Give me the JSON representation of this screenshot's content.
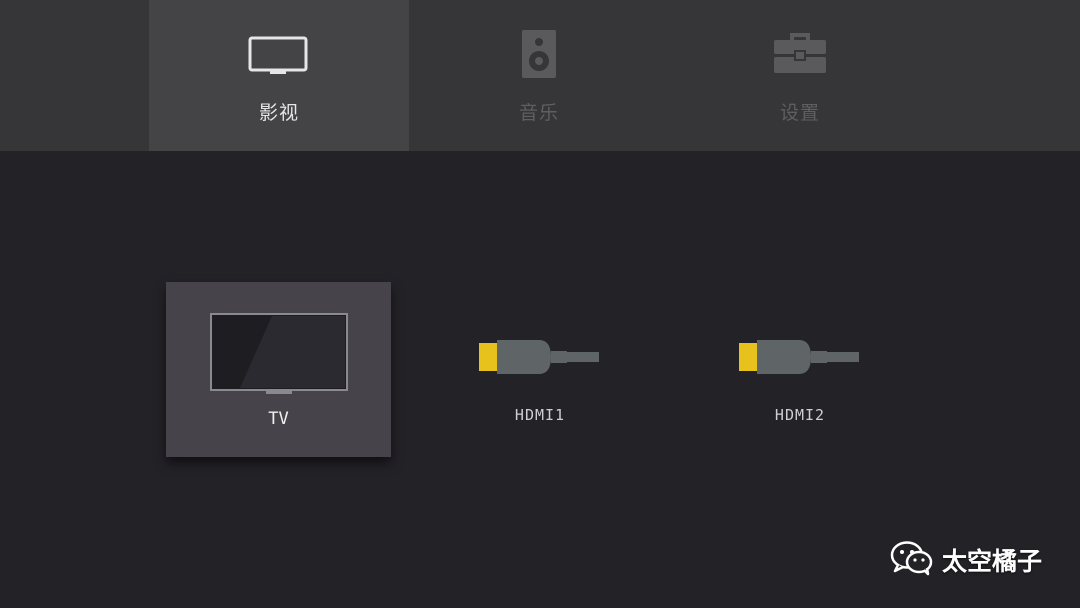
{
  "tabs": [
    {
      "label": "影视",
      "icon": "tv-icon",
      "active": true
    },
    {
      "label": "音乐",
      "icon": "speaker-icon",
      "active": false
    },
    {
      "label": "设置",
      "icon": "toolbox-icon",
      "active": false
    }
  ],
  "sources": [
    {
      "label": "TV",
      "icon": "tv-screen-icon",
      "selected": true
    },
    {
      "label": "HDMI1",
      "icon": "hdmi-cable-icon",
      "selected": false
    },
    {
      "label": "HDMI2",
      "icon": "hdmi-cable-icon",
      "selected": false
    }
  ],
  "watermark": {
    "text": "太空橘子",
    "icon": "wechat-icon"
  },
  "colors": {
    "background": "#232227",
    "topbar": "#363538",
    "active_tab": "#444346",
    "selected_tile": "#46444a",
    "hdmi_plug": "#e8c21c",
    "hdmi_body": "#5f6567"
  }
}
